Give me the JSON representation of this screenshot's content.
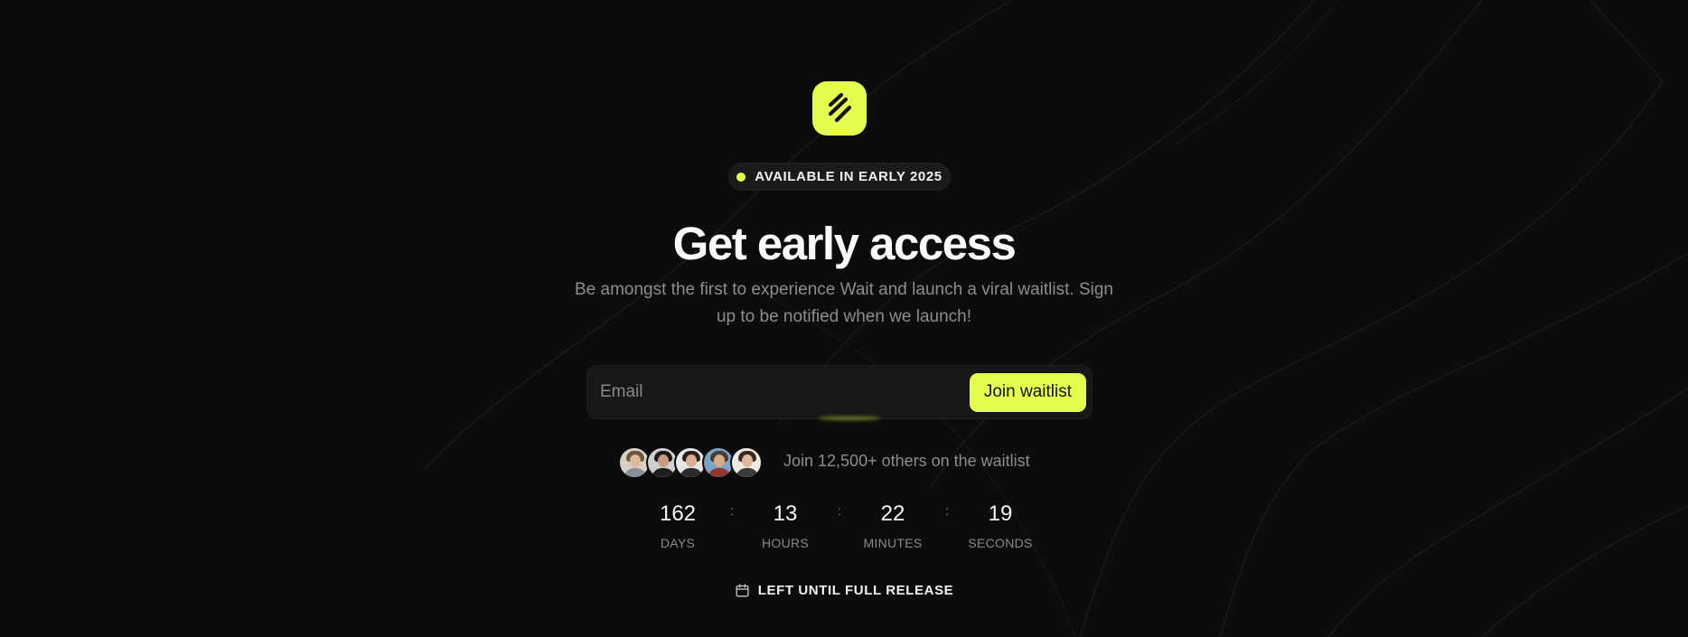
{
  "brand": {
    "accent": "#e4fd4e",
    "background": "#0c0c0c"
  },
  "logo": {
    "icon": "wait-logo-icon"
  },
  "badge": {
    "text": "AVAILABLE IN EARLY 2025",
    "icon": "status-dot-icon"
  },
  "hero": {
    "title": "Get early access",
    "subtitle": "Be amongst the first to experience Wait and launch a viral waitlist. Sign up to be notified when we launch!"
  },
  "form": {
    "email_placeholder": "Email",
    "email_value": "",
    "submit_label": "Join waitlist"
  },
  "social_proof": {
    "text": "Join 12,500+ others on the waitlist",
    "avatars": [
      "avatar-1",
      "avatar-2",
      "avatar-3",
      "avatar-4",
      "avatar-5"
    ]
  },
  "countdown": {
    "units": [
      {
        "value": "162",
        "label": "DAYS"
      },
      {
        "value": "13",
        "label": "HOURS"
      },
      {
        "value": "22",
        "label": "MINUTES"
      },
      {
        "value": "19",
        "label": "SECONDS"
      }
    ],
    "separator": ":"
  },
  "footer": {
    "text": "LEFT UNTIL FULL RELEASE",
    "icon": "calendar-icon"
  }
}
